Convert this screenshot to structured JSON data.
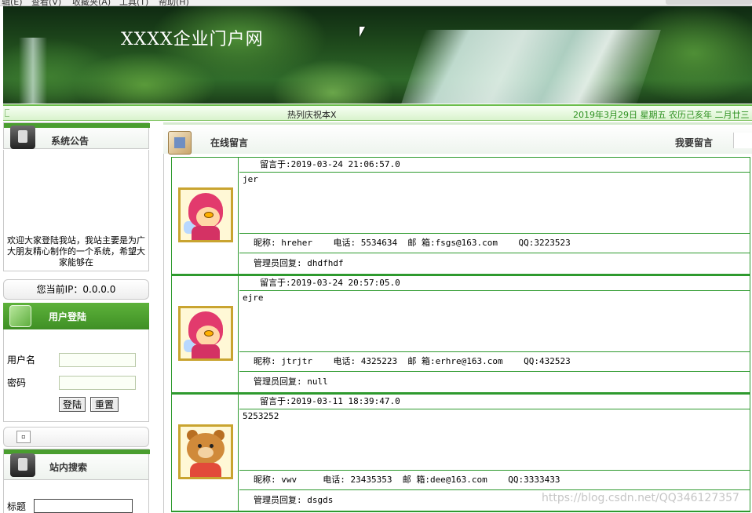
{
  "menubar": {
    "items": [
      "辑(E)",
      "查看(V)",
      "收藏夹(A)",
      "工具(T)",
      "帮助(H)"
    ]
  },
  "banner": {
    "title": "XXXX企业门户网"
  },
  "marquee": {
    "text": "热列庆祝本X",
    "date": "2019年3月29日  星期五  农历己亥年  二月廿三"
  },
  "sidebar": {
    "notice_title": "系统公告",
    "notice_text": "欢迎大家登陆我站，我站主要是为广大朋友精心制作的一个系统，希望大家能够在",
    "ip_label": "您当前IP：0.0.0.0",
    "login_title": "用户登陆",
    "username_label": "用户名",
    "password_label": "密码",
    "login_button": "登陆",
    "reset_button": "重置",
    "small_icon": "▫",
    "search_title": "站内搜索",
    "search_label": "标题"
  },
  "main": {
    "title": "在线留言",
    "post_link": "我要留言"
  },
  "messages": [
    {
      "time": "留言于:2019-03-24 21:06:57.0",
      "content": "jer",
      "info": "昵称: hreher    电话: 5534634  邮 箱:fsgs@163.com    QQ:3223523",
      "reply": "管理员回复: dhdfhdf",
      "avatar": "pink-character"
    },
    {
      "time": "留言于:2019-03-24 20:57:05.0",
      "content": "ejre",
      "info": "昵称: jtrjtr    电话: 4325223  邮 箱:erhre@163.com    QQ:432523",
      "reply": "管理员回复: null",
      "avatar": "pink-character"
    },
    {
      "time": "留言于:2019-03-11 18:39:47.0",
      "content": "5253252",
      "info": "昵称: vwv     电话: 23435353  邮 箱:dee@163.com    QQ:3333433",
      "reply": "管理员回复: dsgds",
      "avatar": "bear-character"
    }
  ],
  "watermark": "https://blog.csdn.net/QQ346127357",
  "colors": {
    "accent_green": "#2e9a2e",
    "date_green": "#2b8f1e",
    "banner_title": "#ffffff"
  }
}
